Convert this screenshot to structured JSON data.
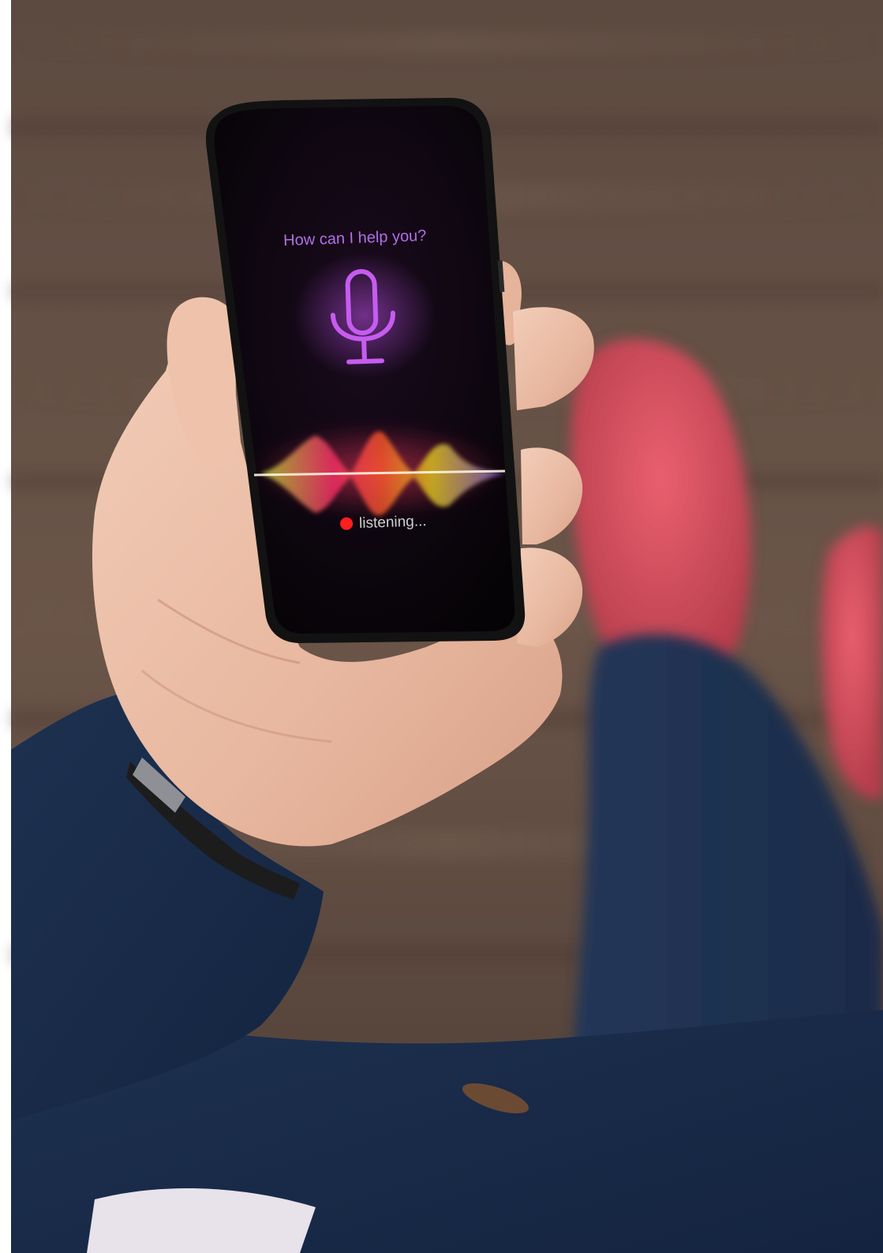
{
  "assistant": {
    "prompt": "How can I help you?",
    "status": "listening...",
    "icon": "microphone-icon"
  },
  "colors": {
    "prompt": "#b36ee8",
    "mic": "#c65cf0",
    "status_text": "#cfcfcf",
    "record_dot": "#ff1e1e",
    "shoe": "#d9505e",
    "jacket": "#182a45"
  }
}
